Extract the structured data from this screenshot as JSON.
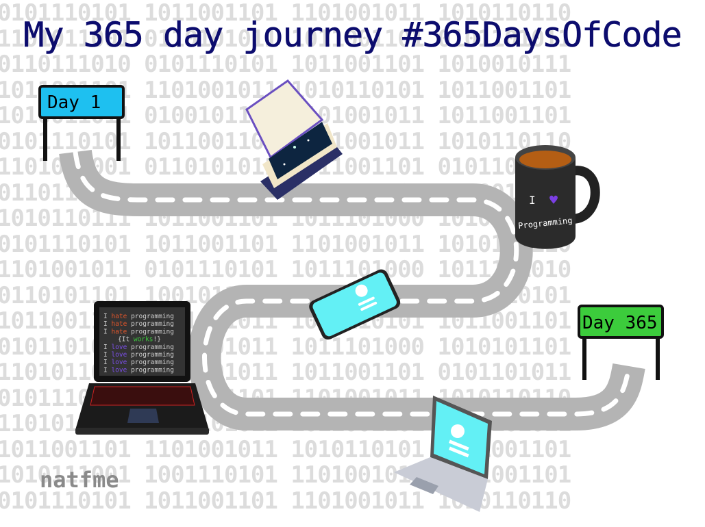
{
  "title": "My 365 day journey #365DaysOfCode",
  "background_binary": [
    "0101110101 1011001101 1101001011 1010110110",
    "1101011001 0110101011 1011001101 0101101011",
    "0110111010 0101110101 1011001101 1010010111",
    "1011001101 1101001011 1010110101 1011001101",
    "1010011011 0100101100 1101001011 1011001101",
    "0101110101 1011001101 1101001011 1010110110",
    "1101011001 0110101011 1011001101 0101101011",
    "0110111010 0101110101 1011001101 1010010111",
    "1010110111 1011001101 1011101000 1010110011",
    "0101110101 1011001101 1101001011 1010110110",
    "1101001011 0101110101 1011101000 1011101010",
    "0110101101 1001011110 1011001101 0110110101",
    "1011001101 1101001011 1010110101 1011001101",
    "0101101011 1101001011 1011101000 1010101101",
    "1101011001 0110101011 1011001101 0101101011",
    "0101110101 1011001101 1101001011 1010110110",
    "1101011001 0110101011 1011001101 0101101011",
    "1011001101 1101001011 1010110101 1011001101",
    "1010111001 1001110101 1101001011 1011001101",
    "0101110101 1011001101 1101001011 1010110110"
  ],
  "signs": {
    "start": "Day 1",
    "end": "Day 365"
  },
  "mug": {
    "line1": "I",
    "line2": "Programming",
    "heart_color": "#7b3fe4"
  },
  "laptop_code": [
    {
      "a": "I ",
      "b": "hate",
      "c": " programming",
      "color": "#e0552b"
    },
    {
      "a": "I ",
      "b": "hate",
      "c": " programming",
      "color": "#e0552b"
    },
    {
      "a": "I ",
      "b": "hate",
      "c": " programming",
      "color": "#e0552b"
    },
    {
      "a": "{It ",
      "b": "works",
      "c": "!}",
      "color": "#3cc63c"
    },
    {
      "a": "I ",
      "b": "love",
      "c": " programming",
      "color": "#7b4fe8"
    },
    {
      "a": "I ",
      "b": "love",
      "c": " programming",
      "color": "#7b4fe8"
    },
    {
      "a": "I ",
      "b": "love",
      "c": " programming",
      "color": "#7b4fe8"
    },
    {
      "a": "I ",
      "b": "love",
      "c": " programming",
      "color": "#7b4fe8"
    }
  ],
  "brand": "natfme",
  "colors": {
    "title": "#0c0c6e",
    "road": "#b4b4b4",
    "sign_start": "#1ec0f0",
    "sign_end": "#3ccc3c",
    "screen": "#63f0f5"
  }
}
